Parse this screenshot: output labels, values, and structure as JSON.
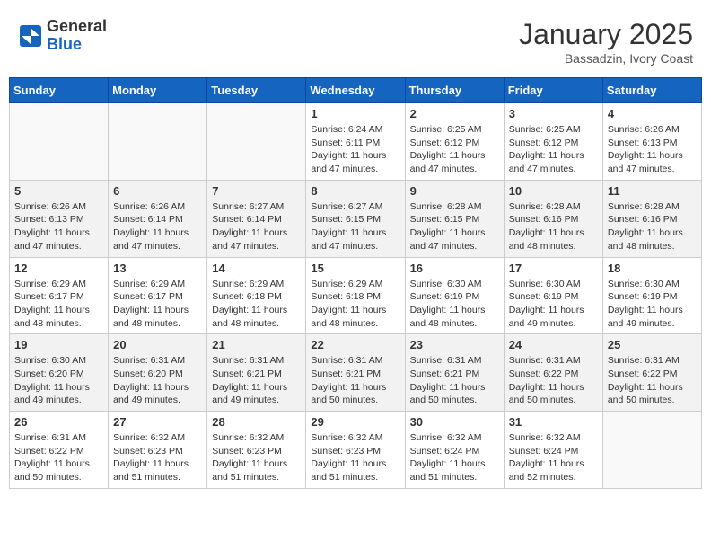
{
  "header": {
    "logo_general": "General",
    "logo_blue": "Blue",
    "month_title": "January 2025",
    "subtitle": "Bassadzin, Ivory Coast"
  },
  "weekdays": [
    "Sunday",
    "Monday",
    "Tuesday",
    "Wednesday",
    "Thursday",
    "Friday",
    "Saturday"
  ],
  "weeks": [
    [
      {
        "day": "",
        "info": ""
      },
      {
        "day": "",
        "info": ""
      },
      {
        "day": "",
        "info": ""
      },
      {
        "day": "1",
        "info": "Sunrise: 6:24 AM\nSunset: 6:11 PM\nDaylight: 11 hours\nand 47 minutes."
      },
      {
        "day": "2",
        "info": "Sunrise: 6:25 AM\nSunset: 6:12 PM\nDaylight: 11 hours\nand 47 minutes."
      },
      {
        "day": "3",
        "info": "Sunrise: 6:25 AM\nSunset: 6:12 PM\nDaylight: 11 hours\nand 47 minutes."
      },
      {
        "day": "4",
        "info": "Sunrise: 6:26 AM\nSunset: 6:13 PM\nDaylight: 11 hours\nand 47 minutes."
      }
    ],
    [
      {
        "day": "5",
        "info": "Sunrise: 6:26 AM\nSunset: 6:13 PM\nDaylight: 11 hours\nand 47 minutes."
      },
      {
        "day": "6",
        "info": "Sunrise: 6:26 AM\nSunset: 6:14 PM\nDaylight: 11 hours\nand 47 minutes."
      },
      {
        "day": "7",
        "info": "Sunrise: 6:27 AM\nSunset: 6:14 PM\nDaylight: 11 hours\nand 47 minutes."
      },
      {
        "day": "8",
        "info": "Sunrise: 6:27 AM\nSunset: 6:15 PM\nDaylight: 11 hours\nand 47 minutes."
      },
      {
        "day": "9",
        "info": "Sunrise: 6:28 AM\nSunset: 6:15 PM\nDaylight: 11 hours\nand 47 minutes."
      },
      {
        "day": "10",
        "info": "Sunrise: 6:28 AM\nSunset: 6:16 PM\nDaylight: 11 hours\nand 48 minutes."
      },
      {
        "day": "11",
        "info": "Sunrise: 6:28 AM\nSunset: 6:16 PM\nDaylight: 11 hours\nand 48 minutes."
      }
    ],
    [
      {
        "day": "12",
        "info": "Sunrise: 6:29 AM\nSunset: 6:17 PM\nDaylight: 11 hours\nand 48 minutes."
      },
      {
        "day": "13",
        "info": "Sunrise: 6:29 AM\nSunset: 6:17 PM\nDaylight: 11 hours\nand 48 minutes."
      },
      {
        "day": "14",
        "info": "Sunrise: 6:29 AM\nSunset: 6:18 PM\nDaylight: 11 hours\nand 48 minutes."
      },
      {
        "day": "15",
        "info": "Sunrise: 6:29 AM\nSunset: 6:18 PM\nDaylight: 11 hours\nand 48 minutes."
      },
      {
        "day": "16",
        "info": "Sunrise: 6:30 AM\nSunset: 6:19 PM\nDaylight: 11 hours\nand 48 minutes."
      },
      {
        "day": "17",
        "info": "Sunrise: 6:30 AM\nSunset: 6:19 PM\nDaylight: 11 hours\nand 49 minutes."
      },
      {
        "day": "18",
        "info": "Sunrise: 6:30 AM\nSunset: 6:19 PM\nDaylight: 11 hours\nand 49 minutes."
      }
    ],
    [
      {
        "day": "19",
        "info": "Sunrise: 6:30 AM\nSunset: 6:20 PM\nDaylight: 11 hours\nand 49 minutes."
      },
      {
        "day": "20",
        "info": "Sunrise: 6:31 AM\nSunset: 6:20 PM\nDaylight: 11 hours\nand 49 minutes."
      },
      {
        "day": "21",
        "info": "Sunrise: 6:31 AM\nSunset: 6:21 PM\nDaylight: 11 hours\nand 49 minutes."
      },
      {
        "day": "22",
        "info": "Sunrise: 6:31 AM\nSunset: 6:21 PM\nDaylight: 11 hours\nand 50 minutes."
      },
      {
        "day": "23",
        "info": "Sunrise: 6:31 AM\nSunset: 6:21 PM\nDaylight: 11 hours\nand 50 minutes."
      },
      {
        "day": "24",
        "info": "Sunrise: 6:31 AM\nSunset: 6:22 PM\nDaylight: 11 hours\nand 50 minutes."
      },
      {
        "day": "25",
        "info": "Sunrise: 6:31 AM\nSunset: 6:22 PM\nDaylight: 11 hours\nand 50 minutes."
      }
    ],
    [
      {
        "day": "26",
        "info": "Sunrise: 6:31 AM\nSunset: 6:22 PM\nDaylight: 11 hours\nand 50 minutes."
      },
      {
        "day": "27",
        "info": "Sunrise: 6:32 AM\nSunset: 6:23 PM\nDaylight: 11 hours\nand 51 minutes."
      },
      {
        "day": "28",
        "info": "Sunrise: 6:32 AM\nSunset: 6:23 PM\nDaylight: 11 hours\nand 51 minutes."
      },
      {
        "day": "29",
        "info": "Sunrise: 6:32 AM\nSunset: 6:23 PM\nDaylight: 11 hours\nand 51 minutes."
      },
      {
        "day": "30",
        "info": "Sunrise: 6:32 AM\nSunset: 6:24 PM\nDaylight: 11 hours\nand 51 minutes."
      },
      {
        "day": "31",
        "info": "Sunrise: 6:32 AM\nSunset: 6:24 PM\nDaylight: 11 hours\nand 52 minutes."
      },
      {
        "day": "",
        "info": ""
      }
    ]
  ]
}
